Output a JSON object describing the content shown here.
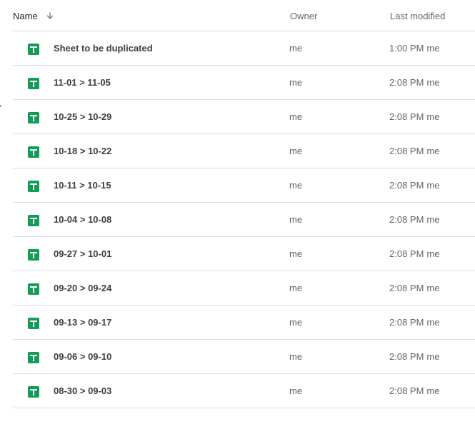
{
  "header": {
    "name_label": "Name",
    "owner_label": "Owner",
    "modified_label": "Last modified",
    "sort_icon": "arrow-down-icon"
  },
  "colors": {
    "sheets_green": "#0f9d58",
    "divider": "#dadce0",
    "text_primary": "#3c4043",
    "text_secondary": "#5f6368"
  },
  "files": [
    {
      "name": "Sheet to be duplicated",
      "owner": "me",
      "modified_time": "1:00 PM",
      "modified_by": "me",
      "icon": "google-sheets-icon"
    },
    {
      "name": "11-01 > 11-05",
      "owner": "me",
      "modified_time": "2:08 PM",
      "modified_by": "me",
      "icon": "google-sheets-icon"
    },
    {
      "name": "10-25 > 10-29",
      "owner": "me",
      "modified_time": "2:08 PM",
      "modified_by": "me",
      "icon": "google-sheets-icon"
    },
    {
      "name": "10-18 > 10-22",
      "owner": "me",
      "modified_time": "2:08 PM",
      "modified_by": "me",
      "icon": "google-sheets-icon"
    },
    {
      "name": "10-11 > 10-15",
      "owner": "me",
      "modified_time": "2:08 PM",
      "modified_by": "me",
      "icon": "google-sheets-icon"
    },
    {
      "name": "10-04 > 10-08",
      "owner": "me",
      "modified_time": "2:08 PM",
      "modified_by": "me",
      "icon": "google-sheets-icon"
    },
    {
      "name": "09-27 > 10-01",
      "owner": "me",
      "modified_time": "2:08 PM",
      "modified_by": "me",
      "icon": "google-sheets-icon"
    },
    {
      "name": "09-20 > 09-24",
      "owner": "me",
      "modified_time": "2:08 PM",
      "modified_by": "me",
      "icon": "google-sheets-icon"
    },
    {
      "name": "09-13 > 09-17",
      "owner": "me",
      "modified_time": "2:08 PM",
      "modified_by": "me",
      "icon": "google-sheets-icon"
    },
    {
      "name": "09-06 > 09-10",
      "owner": "me",
      "modified_time": "2:08 PM",
      "modified_by": "me",
      "icon": "google-sheets-icon"
    },
    {
      "name": "08-30 > 09-03",
      "owner": "me",
      "modified_time": "2:08 PM",
      "modified_by": "me",
      "icon": "google-sheets-icon"
    }
  ]
}
